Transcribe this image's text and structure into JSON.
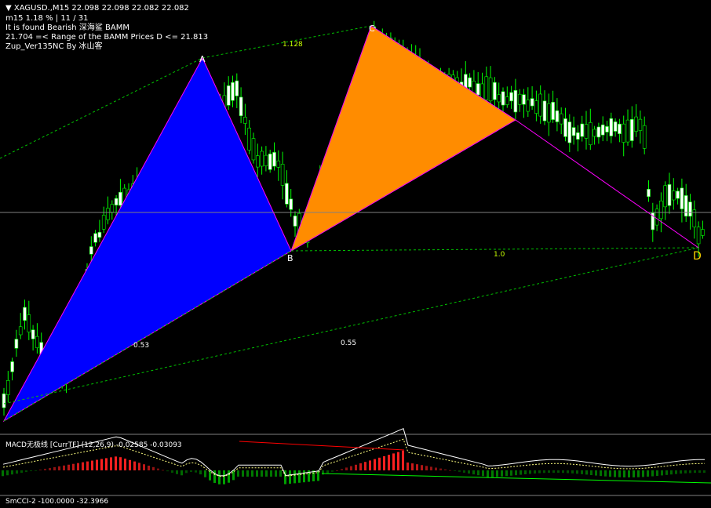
{
  "header": {
    "symbol_line": "XAGUSD.,M15  22.098 22.098 22.082 22.082",
    "info_line": "m15  1.18 %  |  11 / 31",
    "pattern_line": "It is found Bearish 深海鲨 BAMM",
    "range_line": "21.704 =<  Range of the BAMM Prices D <= 21.813",
    "credit_line": "Zup_Ver135NC By 冰山客"
  },
  "colors": {
    "background": "#000000",
    "bull_candle": "#ffffff",
    "bear_candle": "#000000",
    "candle_wick": "#00ff00",
    "triangle_xab": "#0000ff",
    "triangle_bcd": "#ff8c00",
    "zigzag": "#ff00ff",
    "ratio_line": "#00c000",
    "price_line": "#808080",
    "point_label": "#ffffff",
    "point_d": "#ffd700",
    "macd_up": "#ff2020",
    "macd_down": "#00a000",
    "macd_signal": "#ffffff"
  },
  "chart_data": [
    {
      "type": "candlestick",
      "symbol": "XAGUSD.",
      "timeframe": "M15",
      "ohlc_last": {
        "open": 22.098,
        "high": 22.098,
        "low": 22.082,
        "close": 22.082
      },
      "pattern": {
        "name": "BAMM",
        "direction": "Bearish",
        "points": [
          {
            "label": "A"
          },
          {
            "label": "B"
          },
          {
            "label": "C"
          },
          {
            "label": "D"
          }
        ],
        "ratios": [
          "1.128",
          "1.0",
          "0.53",
          "0.55"
        ]
      },
      "d_range": {
        "low": 21.704,
        "high": 21.813
      }
    },
    {
      "type": "bar",
      "title": "MACD无极线 [CurrTF] (12,26,9) -0.02585 -0.03093",
      "params": [
        12,
        26,
        9
      ],
      "main": -0.02585,
      "signal": -0.03093
    },
    {
      "type": "line",
      "title": "SmCCI-2 -100.0000 -32.3966",
      "levels": [
        -100,
        -32.3966
      ]
    }
  ]
}
